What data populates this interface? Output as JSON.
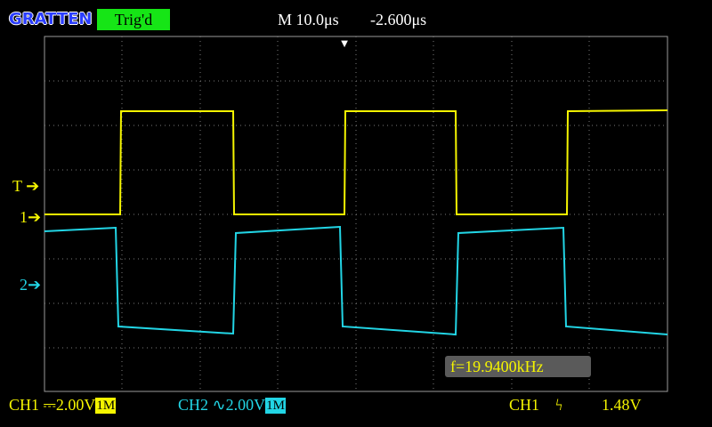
{
  "header": {
    "brand": "GRATTEN",
    "trigger_status": "Trig'd",
    "timebase": "M 10.0μs",
    "horizontal_offset": "-2.600μs"
  },
  "markers": {
    "trigger_level": "T",
    "ch1": "1",
    "ch2": "2"
  },
  "measurement": {
    "frequency": "f=19.9400kHz"
  },
  "status_bar": {
    "ch1_label": "CH1",
    "ch1_coupling_icon": "dc-coupling-icon",
    "ch1_scale": "2.00V",
    "ch1_impedance": "1M",
    "ch2_label": "CH2",
    "ch2_coupling_icon": "ac-coupling-icon",
    "ch2_scale": "2.00V",
    "ch2_impedance": "1M",
    "trigger_source": "CH1",
    "trigger_edge_icon": "rising-edge-icon",
    "trigger_level": "1.48V"
  },
  "colors": {
    "background": "#000000",
    "ch1": "#f5f500",
    "ch2": "#22d5e5",
    "trigged_badge": "#16e516",
    "grid": "#9a9a9a"
  },
  "chart_data": {
    "type": "line",
    "series": [
      {
        "name": "CH1",
        "x": [
          "0",
          "7.8",
          "7.8",
          "22.5",
          "22.5",
          "35.8",
          "35.8",
          "50.6",
          "50.6",
          "63.6",
          "63.6",
          "78.1",
          "78.1",
          "87.5"
        ],
        "values": [
          0.0,
          0.0,
          4.8,
          4.8,
          0.0,
          0.0,
          4.8,
          4.8,
          0.0,
          0.0,
          4.8,
          4.8,
          0.0,
          0.0
        ]
      }
    ]
  }
}
